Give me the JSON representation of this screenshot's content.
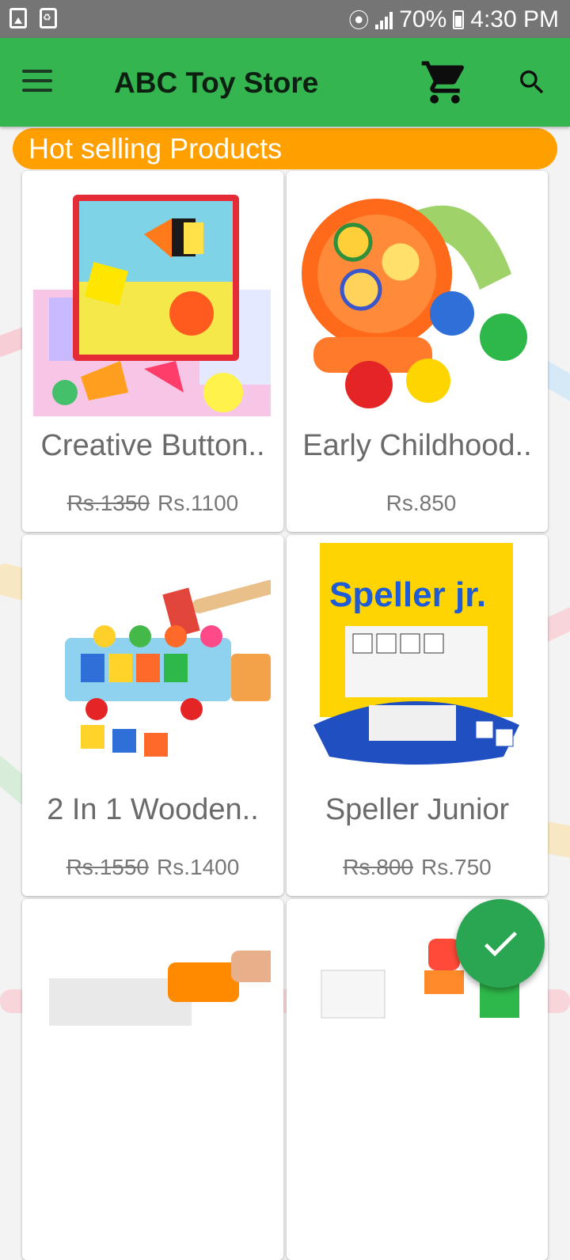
{
  "status_bar": {
    "battery": "70%",
    "time": "4:30 PM",
    "icons": [
      "image-icon",
      "recycle-icon",
      "wifi-icon",
      "signal-icon",
      "battery-icon"
    ]
  },
  "app_bar": {
    "title": "ABC Toy Store",
    "icons": [
      "menu-icon",
      "cart-icon",
      "search-icon"
    ]
  },
  "section": {
    "title": "Hot selling Products"
  },
  "products": [
    {
      "name": "Creative Button..",
      "old_price": "Rs.1350",
      "price": "Rs.1100"
    },
    {
      "name": "Early Childhood..",
      "old_price": "",
      "price": "Rs.850"
    },
    {
      "name": "2 In 1 Wooden..",
      "old_price": "Rs.1550",
      "price": "Rs.1400"
    },
    {
      "name": "Speller Junior",
      "old_price": "Rs.800",
      "price": "Rs.750"
    }
  ],
  "fab": {
    "icon": "check-icon"
  },
  "colors": {
    "app_bar": "#34b54f",
    "section_pill": "#ffa000",
    "fab": "#2aa653",
    "status_bar": "#757575"
  }
}
